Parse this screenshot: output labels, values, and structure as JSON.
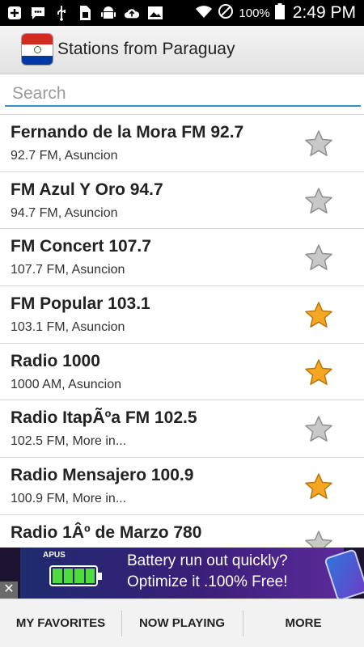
{
  "status_bar": {
    "icons": [
      "add-box-icon",
      "chat-icon",
      "usb-icon",
      "sim-icon",
      "android-icon",
      "upload-icon",
      "image-icon"
    ],
    "battery": "100%",
    "time": "2:49 PM"
  },
  "header": {
    "title": "Stations from Paraguay",
    "flag_icon": "paraguay-flag-icon"
  },
  "search": {
    "placeholder": "Search",
    "value": ""
  },
  "stations": [
    {
      "name": "Fernando de la Mora FM 92.7",
      "detail": "92.7 FM, Asuncion",
      "favorite": false
    },
    {
      "name": "FM Azul Y Oro 94.7",
      "detail": "94.7 FM, Asuncion",
      "favorite": false
    },
    {
      "name": "FM Concert 107.7",
      "detail": "107.7 FM, Asuncion",
      "favorite": false
    },
    {
      "name": "FM Popular 103.1",
      "detail": "103.1 FM, Asuncion",
      "favorite": true
    },
    {
      "name": "Radio 1000",
      "detail": "1000 AM, Asuncion",
      "favorite": true
    },
    {
      "name": "Radio ItapÃºa FM 102.5",
      "detail": "102.5 FM, More in...",
      "favorite": false
    },
    {
      "name": "Radio Mensajero 100.9",
      "detail": "100.9 FM, More in...",
      "favorite": true
    },
    {
      "name": "Radio 1Âº de Marzo 780",
      "detail": "",
      "favorite": false
    }
  ],
  "ad": {
    "brand": "APUS",
    "line1": "Battery run out quickly?",
    "line2": "Optimize it .100% Free!",
    "close": "✕"
  },
  "tabs": [
    {
      "label": "MY FAVORITES"
    },
    {
      "label": "NOW PLAYING"
    },
    {
      "label": "MORE"
    }
  ],
  "colors": {
    "accent": "#3a8fc4",
    "star_on": "#f5a623",
    "star_off": "#c8c8c8"
  }
}
